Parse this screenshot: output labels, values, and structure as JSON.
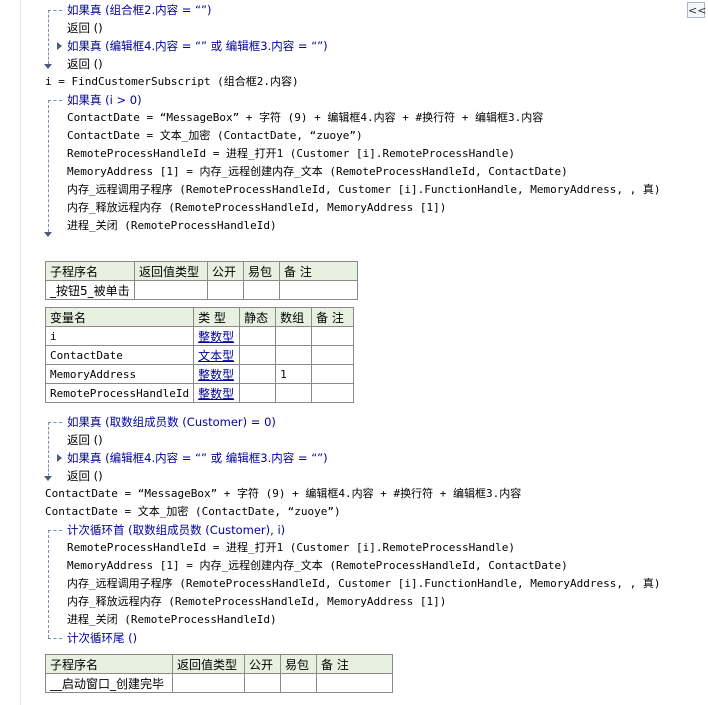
{
  "toolbar": {
    "collapse_label": "<<"
  },
  "code1": [
    "如果真 (组合框2.内容 = “”)",
    "返回 ()",
    "如果真 (编辑框4.内容 = “” 或 编辑框3.内容 = “”)",
    "返回 ()",
    "i = FindCustomerSubscript (组合框2.内容)",
    "如果真 (i > 0)",
    "ContactDate = “MessageBox” + 字符 (9) + 编辑框4.内容 + #换行符 + 编辑框3.内容",
    "ContactDate = 文本_加密 (ContactDate, “zuoye”)",
    "RemoteProcessHandleId = 进程_打开1 (Customer [i].RemoteProcessHandle)",
    "MemoryAddress [1] = 内存_远程创建内存_文本 (RemoteProcessHandleId, ContactDate)",
    "内存_远程调用子程序 (RemoteProcessHandleId, Customer [i].FunctionHandle, MemoryAddress, , 真)",
    "内存_释放远程内存 (RemoteProcessHandleId, MemoryAddress [1])",
    "进程_关闭 (RemoteProcessHandleId)"
  ],
  "sub1": {
    "headers": [
      "子程序名",
      "返回值类型",
      "公开",
      "易包",
      "备 注"
    ],
    "name": "_按钮5_被单击"
  },
  "vars": {
    "headers": [
      "变量名",
      "类 型",
      "静态",
      "数组",
      "备 注"
    ],
    "rows": [
      {
        "name": "i",
        "type": "整数型",
        "static": "",
        "array": "",
        "note": ""
      },
      {
        "name": "ContactDate",
        "type": "文本型",
        "static": "",
        "array": "",
        "note": ""
      },
      {
        "name": "MemoryAddress",
        "type": "整数型",
        "static": "",
        "array": "1",
        "note": ""
      },
      {
        "name": "RemoteProcessHandleId",
        "type": "整数型",
        "static": "",
        "array": "",
        "note": ""
      }
    ]
  },
  "code2": [
    "如果真 (取数组成员数 (Customer) = 0)",
    "返回 ()",
    "如果真 (编辑框4.内容 = “” 或 编辑框3.内容 = “”)",
    "返回 ()",
    "ContactDate = “MessageBox” + 字符 (9) + 编辑框4.内容 + #换行符 + 编辑框3.内容",
    "ContactDate = 文本_加密 (ContactDate, “zuoye”)",
    "计次循环首 (取数组成员数 (Customer), i)",
    "RemoteProcessHandleId = 进程_打开1 (Customer [i].RemoteProcessHandle)",
    "MemoryAddress [1] = 内存_远程创建内存_文本 (RemoteProcessHandleId, ContactDate)",
    "内存_远程调用子程序 (RemoteProcessHandleId, Customer [i].FunctionHandle, MemoryAddress, , 真)",
    "内存_释放远程内存 (RemoteProcessHandleId, MemoryAddress [1])",
    "进程_关闭 (RemoteProcessHandleId)",
    "计次循环尾 ()"
  ],
  "sub2": {
    "headers": [
      "子程序名",
      "返回值类型",
      "公开",
      "易包",
      "备 注"
    ],
    "name": "__启动窗口_创建完毕"
  }
}
